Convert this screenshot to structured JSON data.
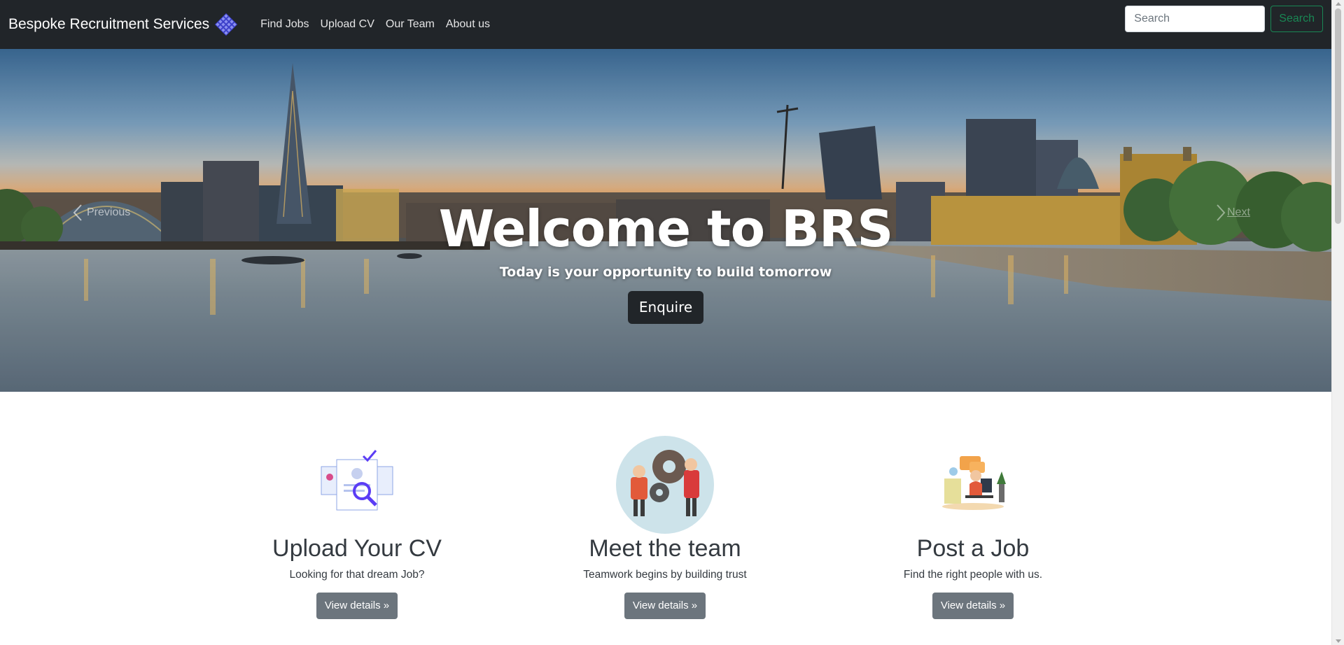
{
  "navbar": {
    "brand": "Bespoke Recruitment Services",
    "brand_logo_icon": "diamond-grid-logo",
    "links": [
      "Find Jobs",
      "Upload CV",
      "Our Team",
      "About us"
    ],
    "search": {
      "placeholder": "Search",
      "button_label": "Search"
    },
    "colors": {
      "background": "#212529",
      "search_button": "#198754"
    }
  },
  "hero": {
    "title": "Welcome to BRS",
    "subtitle": "Today is your opportunity to build tomorrow",
    "button_label": "Enquire",
    "prev_label": "Previous",
    "next_label": "Next",
    "image": "london-skyline-river-thames-at-dusk"
  },
  "features": [
    {
      "icon": "cv-search-illustration",
      "title": "Upload Your CV",
      "description": "Looking for that dream Job?",
      "button_label": "View details »"
    },
    {
      "icon": "team-gears-illustration",
      "title": "Meet the team",
      "description": "Teamwork begins by building trust",
      "button_label": "View details »"
    },
    {
      "icon": "job-desk-illustration",
      "title": "Post a Job",
      "description": "Find the right people with us.",
      "button_label": "View details »"
    }
  ]
}
